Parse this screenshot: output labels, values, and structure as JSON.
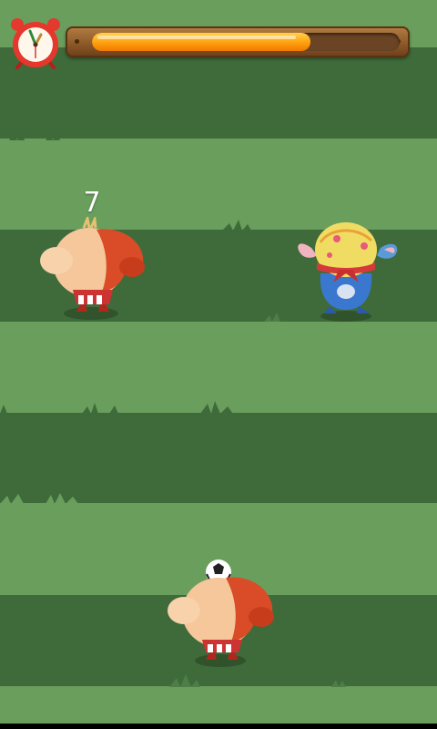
{
  "hud": {
    "clock_icon": "alarm-clock-icon",
    "timer_progress": 0.71,
    "timer_fill_color": "#ff9f0e"
  },
  "field": {
    "light_color": "#6a9e5c",
    "dark_color": "#3f6b3b"
  },
  "characters": [
    {
      "name": "dog-opponent",
      "lane": 1,
      "column": "left",
      "score_label": "7"
    },
    {
      "name": "blue-cat-opponent",
      "lane": 1,
      "column": "right"
    },
    {
      "name": "dog-player",
      "lane": 3,
      "column": "center",
      "holding": "soccer-ball"
    }
  ]
}
